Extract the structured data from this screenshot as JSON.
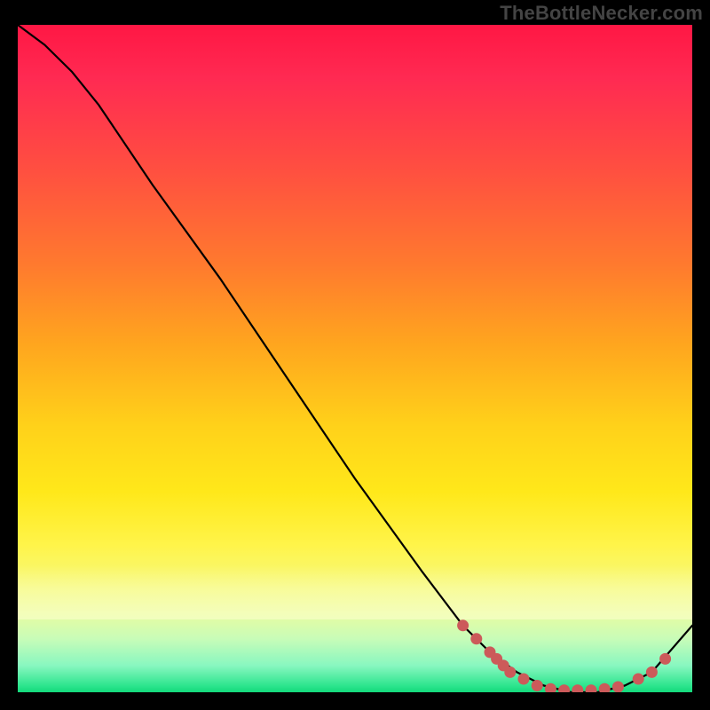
{
  "watermark": "TheBottleNecker.com",
  "chart_data": {
    "type": "line",
    "title": "",
    "xlabel": "",
    "ylabel": "",
    "xlim": [
      0,
      100
    ],
    "ylim": [
      0,
      100
    ],
    "background_gradient": {
      "orientation": "vertical",
      "stops": [
        {
          "pos": 0,
          "color": "#ff1744"
        },
        {
          "pos": 60,
          "color": "#ffd11a"
        },
        {
          "pos": 88,
          "color": "#e9fca0"
        },
        {
          "pos": 100,
          "color": "#13d97b"
        }
      ]
    },
    "series": [
      {
        "name": "bottleneck-curve",
        "x": [
          0,
          4,
          8,
          12,
          20,
          30,
          40,
          50,
          60,
          66,
          70,
          74,
          78,
          82,
          86,
          90,
          94,
          100
        ],
        "values": [
          100,
          97,
          93,
          88,
          76,
          62,
          47,
          32,
          18,
          10,
          6,
          3,
          1,
          0,
          0,
          1,
          3,
          10
        ]
      }
    ],
    "markers": {
      "name": "highlight-dots",
      "color": "#cc5a5a",
      "points": [
        {
          "x": 66,
          "y": 10
        },
        {
          "x": 68,
          "y": 8
        },
        {
          "x": 70,
          "y": 6
        },
        {
          "x": 71,
          "y": 5
        },
        {
          "x": 72,
          "y": 4
        },
        {
          "x": 73,
          "y": 3
        },
        {
          "x": 75,
          "y": 2
        },
        {
          "x": 77,
          "y": 1
        },
        {
          "x": 79,
          "y": 0.5
        },
        {
          "x": 81,
          "y": 0.3
        },
        {
          "x": 83,
          "y": 0.3
        },
        {
          "x": 85,
          "y": 0.3
        },
        {
          "x": 87,
          "y": 0.5
        },
        {
          "x": 89,
          "y": 0.8
        },
        {
          "x": 92,
          "y": 2
        },
        {
          "x": 94,
          "y": 3
        },
        {
          "x": 96,
          "y": 5
        }
      ]
    }
  }
}
